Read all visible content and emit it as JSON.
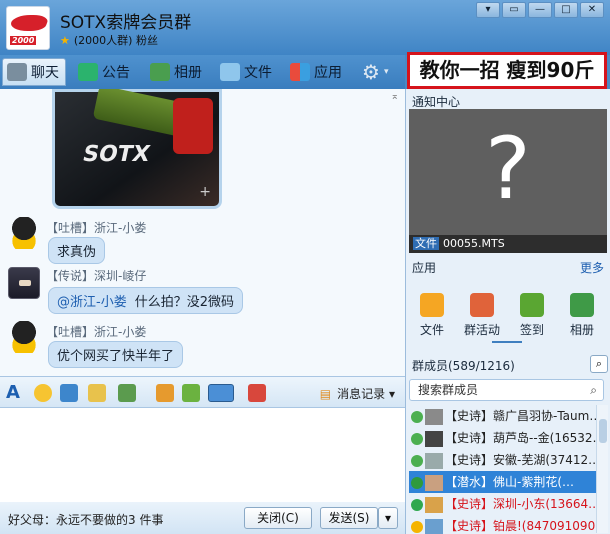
{
  "window": {
    "group_name": "SOTX索牌会员群",
    "group_sub": "(2000人群) 粉丝",
    "logo_text": "2000",
    "controls": [
      "▾",
      "▭",
      "—",
      "□",
      "✕"
    ]
  },
  "tabs": [
    {
      "label": "聊天",
      "icon": "chat-icon",
      "active": true
    },
    {
      "label": "公告",
      "icon": "megaphone-icon"
    },
    {
      "label": "相册",
      "icon": "album-icon"
    },
    {
      "label": "文件",
      "icon": "folder-icon"
    },
    {
      "label": "应用",
      "icon": "apps-icon"
    }
  ],
  "ad_banner": "教你一招 瘦到90斤",
  "photo_text": "SOTX",
  "messages": [
    {
      "header": "【吐槽】浙江-小娄",
      "text": "求真伪"
    },
    {
      "header": "【传说】深圳-崚仔",
      "mention": "@浙江-小娄",
      "text": "什么拍？没2微码"
    },
    {
      "header": "【吐槽】浙江-小娄",
      "text": "优个网买了快半年了"
    }
  ],
  "toolbar": {
    "history_label": "消息记录"
  },
  "bottom": {
    "tip": "好父母：永远不要做的3 件事",
    "close_label": "关闭(C)",
    "send_label": "发送(S)"
  },
  "right": {
    "notify_title": "通知中心",
    "notify_tag": "文件",
    "notify_file": "00055.MTS",
    "apps_title": "应用",
    "more_label": "更多",
    "apps": [
      {
        "label": "文件",
        "icon": "file-app-icon",
        "color": "#f5a623"
      },
      {
        "label": "群活动",
        "icon": "flag-app-icon",
        "color": "#e0633a"
      },
      {
        "label": "签到",
        "icon": "checkin-app-icon",
        "color": "#5aa632"
      },
      {
        "label": "相册",
        "icon": "album-app-icon",
        "color": "#3f9a47"
      }
    ],
    "members_title": "群成员(589/1216)",
    "search_placeholder": "搜索群成员",
    "members": [
      {
        "text": "【史诗】赣广昌羽协-Taum…"
      },
      {
        "text": "【史诗】葫芦岛--金(16532…"
      },
      {
        "text": "【史诗】安徽-芜湖(37412…"
      },
      {
        "text": "【潜水】佛山-紫荆花(…",
        "selected": true
      },
      {
        "text": "【史诗】深圳-小东(13664…",
        "red": true
      },
      {
        "text": "【史诗】铂晨!(847091090)",
        "red": true
      }
    ]
  },
  "colors": {
    "accent": "#2f83d7",
    "ad_border": "#d6131b"
  }
}
